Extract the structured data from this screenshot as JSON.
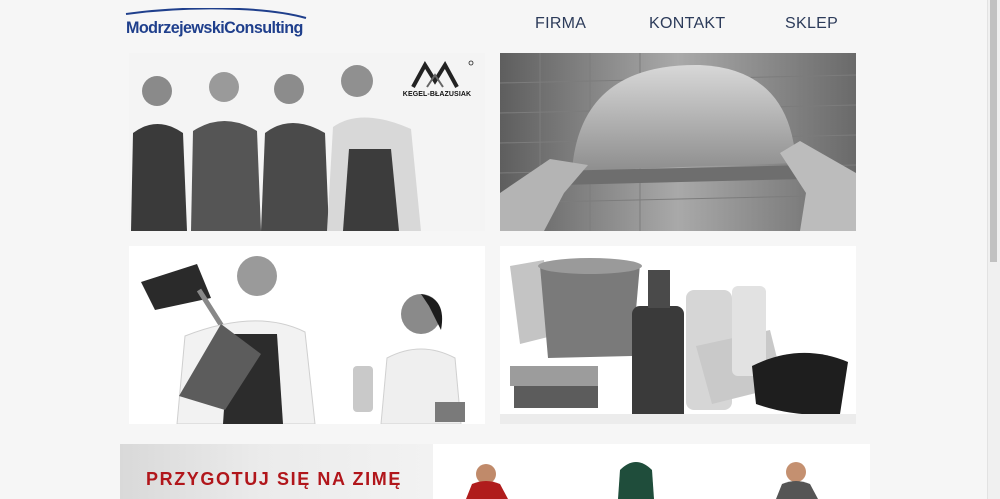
{
  "header": {
    "logo_text": "ModrzejewskiConsulting"
  },
  "nav": {
    "items": [
      {
        "label": "FIRMA"
      },
      {
        "label": "KONTAKT"
      },
      {
        "label": "SKLEP"
      }
    ]
  },
  "tiles": {
    "workers_brand": "KEGEL-BŁAZUSIAK"
  },
  "banner": {
    "title": "PRZYGOTUJ SIĘ NA ZIMĘ"
  },
  "colors": {
    "page_background": "#f6f6f6",
    "logo_blue": "#1f3f8c",
    "nav_text": "#2c3b5a",
    "banner_red": "#b1161b"
  }
}
